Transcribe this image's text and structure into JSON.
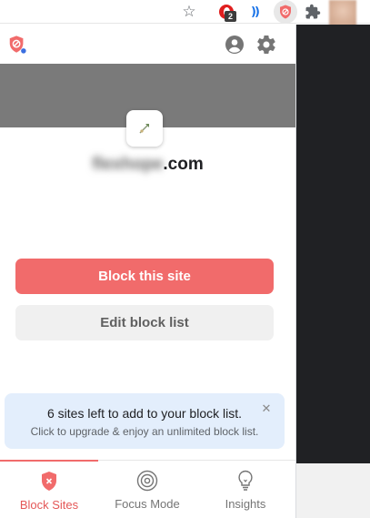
{
  "browser_toolbar": {
    "icons": [
      "star-icon",
      "opera-extension-icon",
      "wave-extension-icon",
      "blocksite-extension-icon",
      "puzzle-extensions-icon",
      "profile-avatar"
    ],
    "opera_badge": "2"
  },
  "popup": {
    "header": {
      "logo": "blocksite-shield-logo",
      "icons": [
        "account-icon",
        "gear-icon"
      ]
    },
    "site": {
      "name_blurred": "flexhope",
      "tld": ".com"
    },
    "buttons": {
      "block": "Block this site",
      "edit": "Edit block list"
    },
    "notice": {
      "title": "6 sites left to add to your block list.",
      "subtitle": "Click to upgrade & enjoy an unlimited block list."
    },
    "nav": [
      {
        "label": "Block Sites",
        "icon": "shield-x-icon",
        "active": true
      },
      {
        "label": "Focus Mode",
        "icon": "target-icon",
        "active": false
      },
      {
        "label": "Insights",
        "icon": "lightbulb-icon",
        "active": false
      }
    ]
  },
  "colors": {
    "accent": "#f16b6b",
    "banner": "#7a7a7a",
    "notice_bg": "#e3eefc",
    "dark_area": "#202124"
  }
}
